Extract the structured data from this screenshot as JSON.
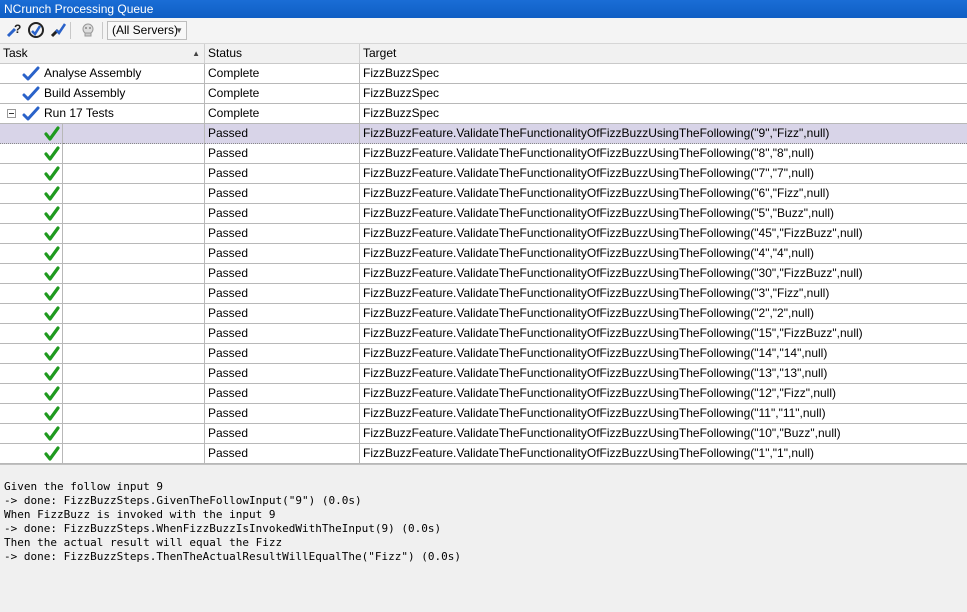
{
  "window": {
    "title": "NCrunch Processing Queue"
  },
  "toolbar": {
    "server_filter": "(All Servers)",
    "icons": [
      "help-icon",
      "engine-icon",
      "tests-icon",
      "clear-icon"
    ]
  },
  "grid": {
    "columns": {
      "task": "Task",
      "status": "Status",
      "target": "Target"
    },
    "task_rows": [
      {
        "task": "Analyse Assembly",
        "status": "Complete",
        "target": "FizzBuzzSpec"
      },
      {
        "task": "Build Assembly",
        "status": "Complete",
        "target": "FizzBuzzSpec"
      },
      {
        "task": "Run 17 Tests",
        "status": "Complete",
        "target": "FizzBuzzSpec"
      }
    ],
    "test_rows": [
      {
        "status": "Passed",
        "target": "FizzBuzzFeature.ValidateTheFunctionalityOfFizzBuzzUsingTheFollowing(\"9\",\"Fizz\",null)"
      },
      {
        "status": "Passed",
        "target": "FizzBuzzFeature.ValidateTheFunctionalityOfFizzBuzzUsingTheFollowing(\"8\",\"8\",null)"
      },
      {
        "status": "Passed",
        "target": "FizzBuzzFeature.ValidateTheFunctionalityOfFizzBuzzUsingTheFollowing(\"7\",\"7\",null)"
      },
      {
        "status": "Passed",
        "target": "FizzBuzzFeature.ValidateTheFunctionalityOfFizzBuzzUsingTheFollowing(\"6\",\"Fizz\",null)"
      },
      {
        "status": "Passed",
        "target": "FizzBuzzFeature.ValidateTheFunctionalityOfFizzBuzzUsingTheFollowing(\"5\",\"Buzz\",null)"
      },
      {
        "status": "Passed",
        "target": "FizzBuzzFeature.ValidateTheFunctionalityOfFizzBuzzUsingTheFollowing(\"45\",\"FizzBuzz\",null)"
      },
      {
        "status": "Passed",
        "target": "FizzBuzzFeature.ValidateTheFunctionalityOfFizzBuzzUsingTheFollowing(\"4\",\"4\",null)"
      },
      {
        "status": "Passed",
        "target": "FizzBuzzFeature.ValidateTheFunctionalityOfFizzBuzzUsingTheFollowing(\"30\",\"FizzBuzz\",null)"
      },
      {
        "status": "Passed",
        "target": "FizzBuzzFeature.ValidateTheFunctionalityOfFizzBuzzUsingTheFollowing(\"3\",\"Fizz\",null)"
      },
      {
        "status": "Passed",
        "target": "FizzBuzzFeature.ValidateTheFunctionalityOfFizzBuzzUsingTheFollowing(\"2\",\"2\",null)"
      },
      {
        "status": "Passed",
        "target": "FizzBuzzFeature.ValidateTheFunctionalityOfFizzBuzzUsingTheFollowing(\"15\",\"FizzBuzz\",null)"
      },
      {
        "status": "Passed",
        "target": "FizzBuzzFeature.ValidateTheFunctionalityOfFizzBuzzUsingTheFollowing(\"14\",\"14\",null)"
      },
      {
        "status": "Passed",
        "target": "FizzBuzzFeature.ValidateTheFunctionalityOfFizzBuzzUsingTheFollowing(\"13\",\"13\",null)"
      },
      {
        "status": "Passed",
        "target": "FizzBuzzFeature.ValidateTheFunctionalityOfFizzBuzzUsingTheFollowing(\"12\",\"Fizz\",null)"
      },
      {
        "status": "Passed",
        "target": "FizzBuzzFeature.ValidateTheFunctionalityOfFizzBuzzUsingTheFollowing(\"11\",\"11\",null)"
      },
      {
        "status": "Passed",
        "target": "FizzBuzzFeature.ValidateTheFunctionalityOfFizzBuzzUsingTheFollowing(\"10\",\"Buzz\",null)"
      },
      {
        "status": "Passed",
        "target": "FizzBuzzFeature.ValidateTheFunctionalityOfFizzBuzzUsingTheFollowing(\"1\",\"1\",null)"
      }
    ]
  },
  "output": {
    "lines": [
      "Given the follow input 9",
      "-> done: FizzBuzzSteps.GivenTheFollowInput(\"9\") (0.0s)",
      "When FizzBuzz is invoked with the input 9",
      "-> done: FizzBuzzSteps.WhenFizzBuzzIsInvokedWithTheInput(9) (0.0s)",
      "Then the actual result will equal the Fizz",
      "-> done: FizzBuzzSteps.ThenTheActualResultWillEqualThe(\"Fizz\") (0.0s)"
    ]
  },
  "colors": {
    "check_blue": "#2a62c9",
    "check_green": "#1f9a1f",
    "selected_row": "#d8d4e8",
    "titlebar": "#0f5ec4"
  }
}
